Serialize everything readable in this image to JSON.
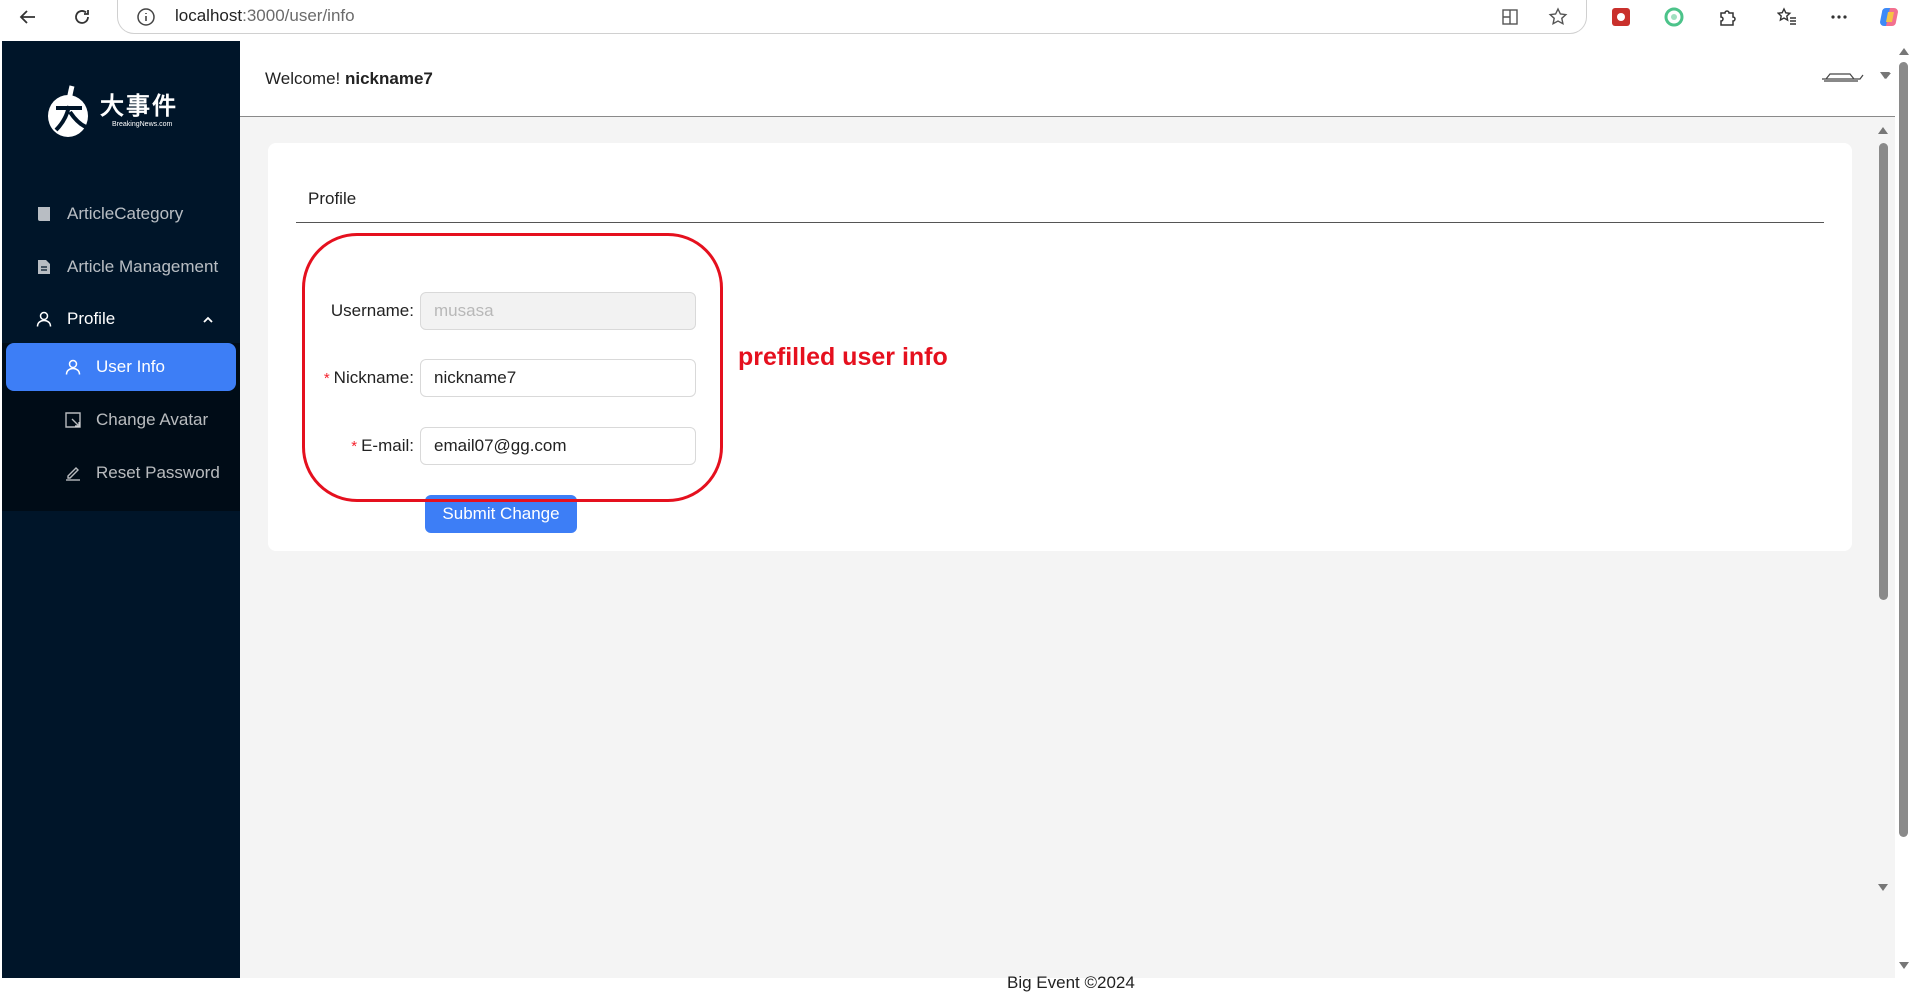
{
  "browser": {
    "url_host": "localhost",
    "url_path": ":3000/user/info"
  },
  "logo": {
    "chinese": "大事件",
    "english": "BreakingNews.com"
  },
  "sidebar": {
    "items": [
      {
        "label": "ArticleCategory",
        "icon": "book-icon"
      },
      {
        "label": "Article Management",
        "icon": "document-icon"
      },
      {
        "label": "Profile",
        "icon": "user-icon"
      }
    ],
    "submenu": [
      {
        "label": "User Info",
        "icon": "user-icon",
        "active": true
      },
      {
        "label": "Change Avatar",
        "icon": "crop-icon"
      },
      {
        "label": "Reset Password",
        "icon": "edit-icon"
      }
    ]
  },
  "header": {
    "welcome_prefix": "Welcome!",
    "nickname": "nickname7"
  },
  "card": {
    "title": "Profile"
  },
  "form": {
    "username_label": "Username",
    "username_value": "musasa",
    "nickname_label": "Nickname",
    "nickname_value": "nickname7",
    "email_label": "E-mail",
    "email_value": "email07@gg.com",
    "label_suffix": ":",
    "required_mark": "*",
    "submit_label": "Submit Change"
  },
  "annotation": {
    "text": "prefilled user info",
    "color": "#e5101e"
  },
  "footer": {
    "text": "Big Event ©2024"
  },
  "colors": {
    "sidebar_bg": "#001529",
    "primary": "#3d7ef6",
    "required": "#f5222d"
  }
}
